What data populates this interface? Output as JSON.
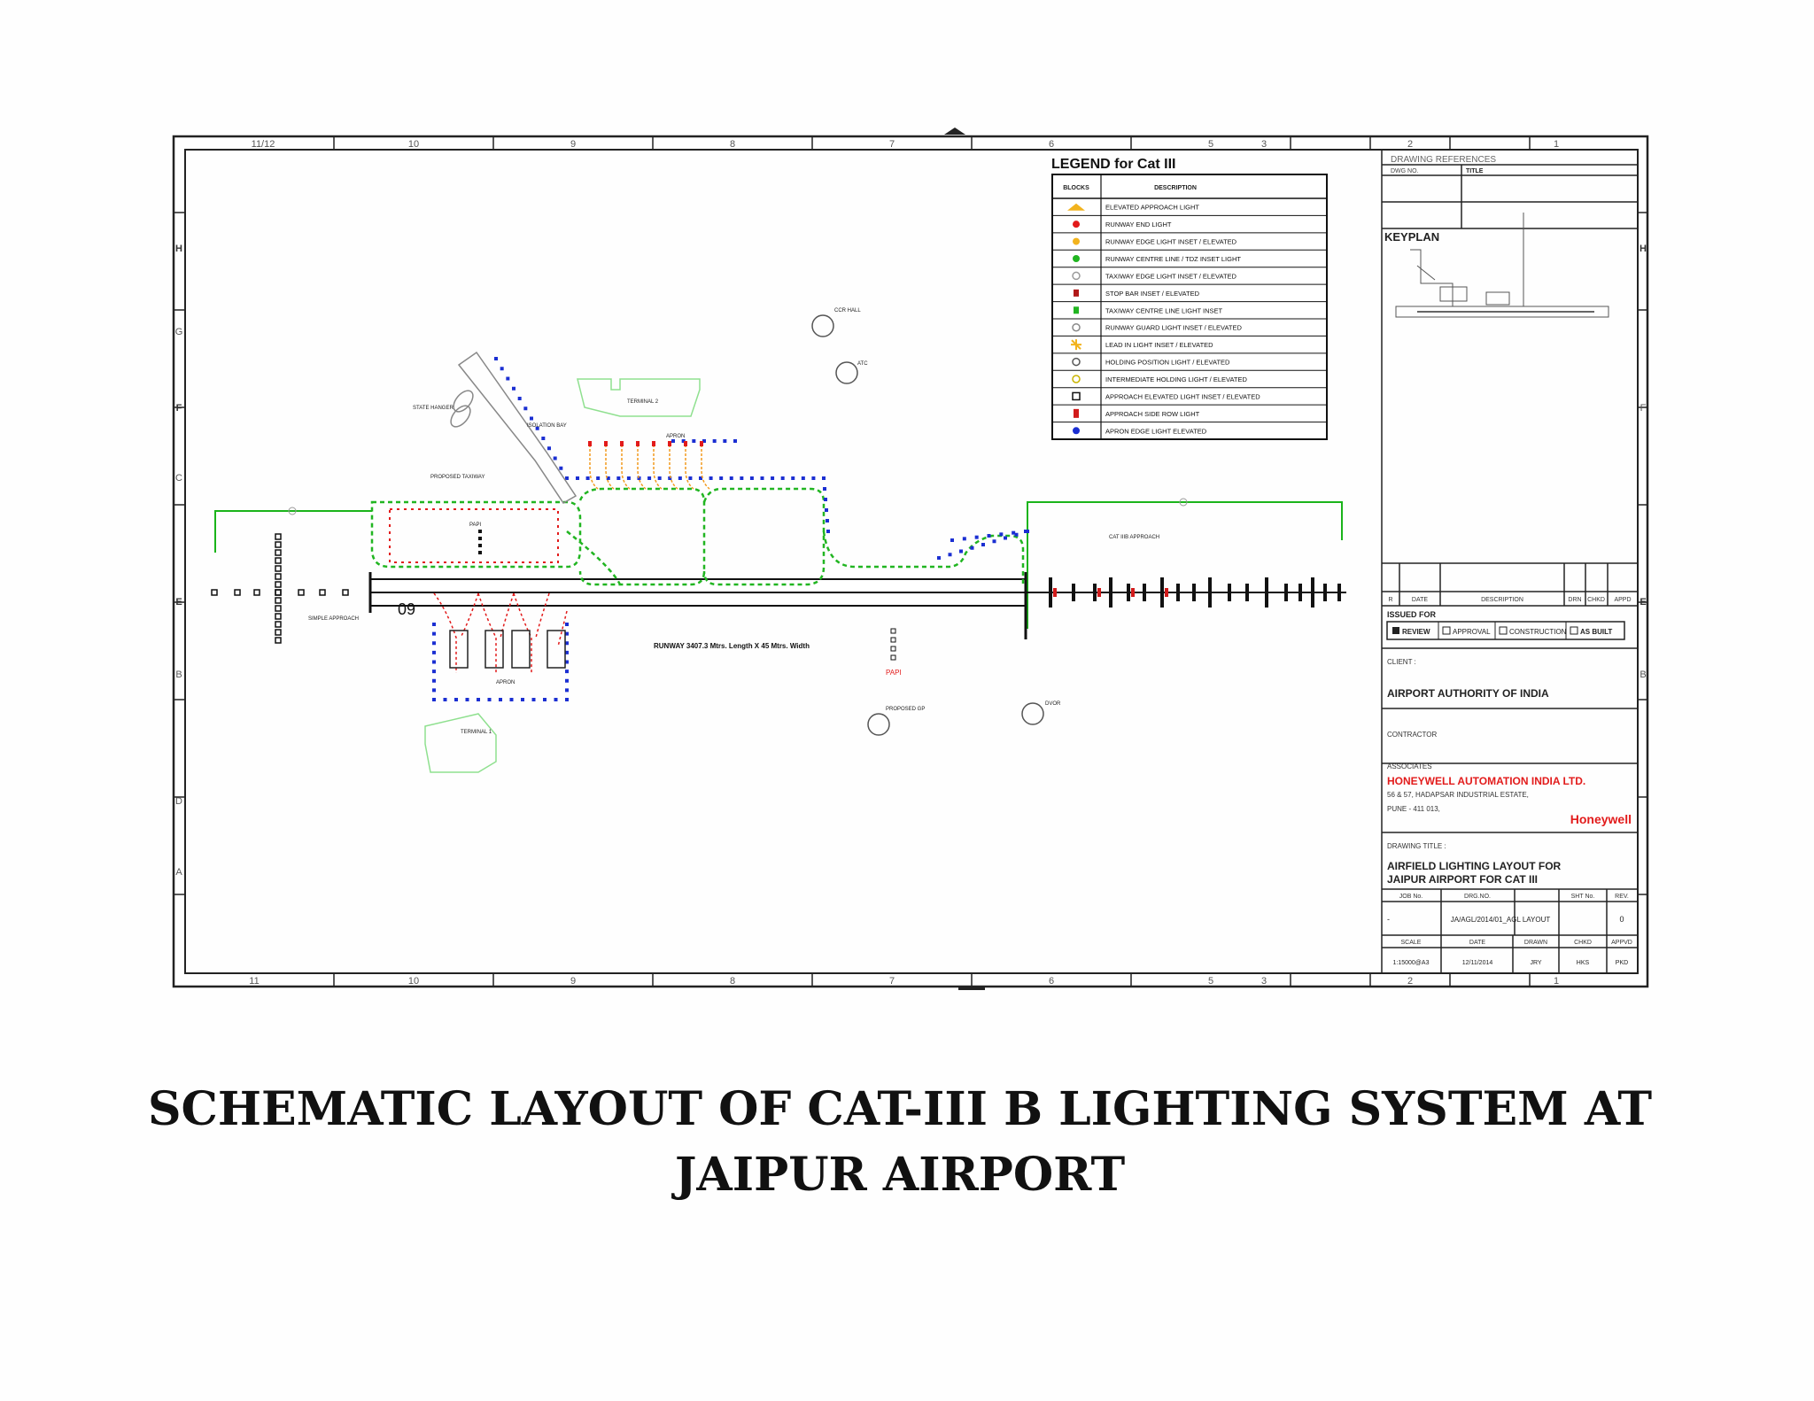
{
  "caption": {
    "line1": "SCHEMATIC LAYOUT OF CAT-III B LIGHTING SYSTEM AT",
    "line2": "JAIPUR AIRPORT"
  },
  "frame": {
    "top_ticks": [
      "11/12",
      "10",
      "9",
      "8",
      "7",
      "6",
      "5",
      "3",
      "2",
      "1"
    ],
    "bottom_ticks": [
      "11",
      "10",
      "9",
      "8",
      "7",
      "6",
      "5",
      "3",
      "2",
      "1"
    ],
    "side_letters": [
      "H",
      "G",
      "F",
      "E",
      "D",
      "C",
      "B",
      "A"
    ]
  },
  "legend": {
    "title": "LEGEND for Cat III",
    "col_symbol": "BLOCKS",
    "col_desc": "DESCRIPTION",
    "rows": [
      {
        "color": "#f2b31e",
        "shape": "tri",
        "desc": "ELEVATED APPROACH LIGHT"
      },
      {
        "color": "#e21b1b",
        "shape": "dot",
        "desc": "RUNWAY END LIGHT"
      },
      {
        "color": "#f2b31e",
        "shape": "dot",
        "desc": "RUNWAY EDGE LIGHT INSET / ELEVATED"
      },
      {
        "color": "#21b521",
        "shape": "dot",
        "desc": "RUNWAY CENTRE LINE / TDZ INSET LIGHT"
      },
      {
        "color": "#9a9a9a",
        "shape": "ring",
        "desc": "TAXIWAY EDGE LIGHT INSET / ELEVATED"
      },
      {
        "color": "#b01818",
        "shape": "sq",
        "desc": "STOP BAR INSET / ELEVATED"
      },
      {
        "color": "#21b521",
        "shape": "sq",
        "desc": "TAXIWAY CENTRE LINE LIGHT INSET"
      },
      {
        "color": "#888888",
        "shape": "ring",
        "desc": "RUNWAY GUARD LIGHT INSET / ELEVATED"
      },
      {
        "color": "#f2b31e",
        "shape": "star",
        "desc": "LEAD IN LIGHT INSET / ELEVATED"
      },
      {
        "color": "#555555",
        "shape": "ring",
        "desc": "HOLDING POSITION LIGHT / ELEVATED"
      },
      {
        "color": "#c9b400",
        "shape": "ring",
        "desc": "INTERMEDIATE HOLDING LIGHT / ELEVATED"
      },
      {
        "color": "#111111",
        "shape": "sqo",
        "desc": "APPROACH ELEVATED LIGHT INSET / ELEVATED"
      },
      {
        "color": "#d21b1b",
        "shape": "bar",
        "desc": "APPROACH SIDE ROW LIGHT"
      },
      {
        "color": "#1b2fd2",
        "shape": "dot",
        "desc": "APRON EDGE LIGHT ELEVATED"
      }
    ]
  },
  "title_block": {
    "drawing_refs_label": "DRAWING REFERENCES",
    "dwg_no_label": "DWG NO.",
    "title_label": "TITLE",
    "keyplan_label": "KEYPLAN",
    "rev_cols": [
      "R",
      "DATE",
      "DESCRIPTION",
      "DRN",
      "CHKD",
      "APPD"
    ],
    "issued_for_label": "ISSUED FOR",
    "issued_options": [
      "REVIEW",
      "APPROVAL",
      "CONSTRUCTION",
      "AS BUILT"
    ],
    "client_label": "CLIENT :",
    "client_name": "AIRPORT AUTHORITY OF INDIA",
    "contractor_label": "CONTRACTOR",
    "associates_label": "ASSOCIATES",
    "company_name": "HONEYWELL AUTOMATION INDIA LTD.",
    "address_line1": "56 & 57, HADAPSAR INDUSTRIAL ESTATE,",
    "address_line2": "PUNE - 411 013,",
    "brand": "Honeywell",
    "drawing_title_label": "DRAWING TITLE :",
    "drawing_title_1": "AIRFIELD LIGHTING LAYOUT FOR",
    "drawing_title_2": "JAIPUR AIRPORT FOR CAT III",
    "job_no_label": "JOB No.",
    "dwg_no_col_label": "DRG.NO.",
    "sht_no_label": "SHT No.",
    "rev_label": "REV.",
    "job_no_value": "-",
    "dwg_no_value": "JA/AGL/2014/01_AGL LAYOUT",
    "rev_value": "0",
    "scale_label": "SCALE",
    "date_label": "DATE",
    "drawn_label": "DRAWN",
    "chkd_label": "CHKD",
    "appvd_label": "APPVD",
    "scale_value": "1:15000@A3",
    "date_value": "12/11/2014",
    "drawn_value": "JRY",
    "chkd_value": "HKS",
    "appvd_value": "PKD"
  },
  "plan": {
    "runway_number": "09",
    "runway_text": "RUNWAY 3407.3 Mtrs. Length  X  45 Mtrs. Width",
    "labels": {
      "ccr_hall": "CCR HALL",
      "atc": "ATC",
      "terminal2": "TERMINAL 2",
      "apron_top": "APRON",
      "state_hanger": "STATE HANGER",
      "isolation_bay": "ISOLATION BAY",
      "proposed_taxiway": "PROPOSED TAXIWAY",
      "papi_left": "PAPI",
      "simple_approach": "SIMPLE APPROACH",
      "cat3_approach": "CAT IIIB APPROACH",
      "apron_bottom": "APRON",
      "terminal1": "TERMINAL 1",
      "papi_right": "PAPI",
      "proposed_gp": "PROPOSED GP",
      "dvor": "DVOR"
    }
  }
}
